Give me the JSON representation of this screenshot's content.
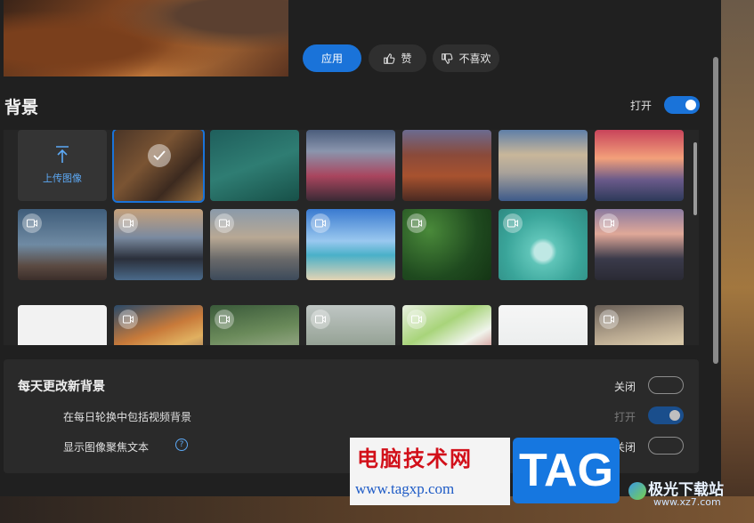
{
  "actions": {
    "apply": "应用",
    "like": "赞",
    "dislike": "不喜欢"
  },
  "background": {
    "title": "背景",
    "toggle_label": "打开",
    "toggle_on": true,
    "upload_label": "上传图像",
    "thumbnails": [
      "desert-cliff",
      "ocean-waves",
      "mount-fuji-pagoda",
      "canyon-river",
      "harbor-town",
      "pier-sunset",
      "dusk-mountains",
      "city-skyline",
      "coastal-town",
      "beach-sky",
      "forest-aerial",
      "water-drop",
      "seaside-cliff-town",
      "white-mist",
      "coral-reef",
      "green-hills",
      "misty-valley",
      "green-leaf",
      "white-splash",
      "sand-dunes"
    ]
  },
  "daily": {
    "title": "每天更改新背景",
    "toggle_label": "关闭",
    "include_video_label": "在每日轮换中包括视频背景",
    "include_video_state": "打开",
    "spotlight_label": "显示图像聚焦文本",
    "spotlight_state": "关闭",
    "help_symbol": "?"
  },
  "watermark": {
    "site_cn": "电脑技术网",
    "site_url": "www.tagxp.com",
    "tag": "TAG",
    "partner_cn": "极光下载站",
    "partner_url": "www.xz7.com"
  },
  "colors": {
    "accent": "#1a73d9",
    "panel": "#202020"
  }
}
